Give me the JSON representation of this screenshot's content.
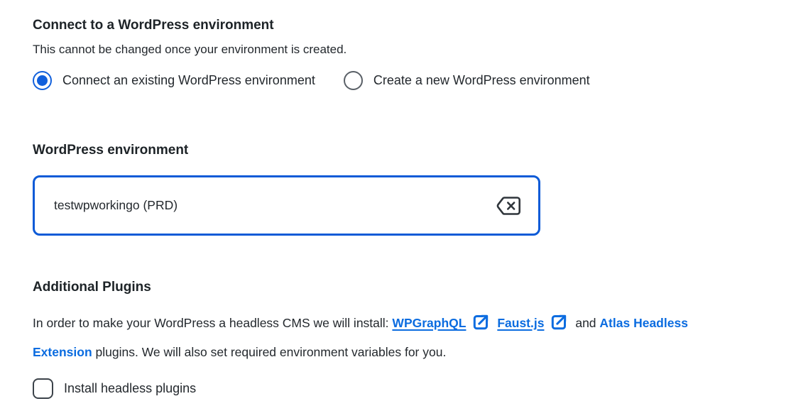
{
  "page": {
    "heading": "Connect to a WordPress environment",
    "subheading": "This cannot be changed once your environment is created."
  },
  "connection_choice": {
    "options": [
      {
        "label": "Connect an existing WordPress environment",
        "selected": true
      },
      {
        "label": "Create a new WordPress environment",
        "selected": false
      }
    ]
  },
  "environment_field": {
    "label": "WordPress environment",
    "value": "testwpworkingo (PRD)",
    "clear_icon": "backspace-clear-icon"
  },
  "plugins_section": {
    "heading": "Additional Plugins",
    "description": {
      "intro": "In order to make your WordPress a headless CMS we will install:",
      "link_wpgraphql": "WPGraphQL",
      "link_faustjs": "Faust.js",
      "conjunction": "and",
      "link_atlas": "Atlas Headless Extension",
      "outro": "plugins. We will also set required environment variables for you.",
      "external_link_icon": "external-link-icon"
    },
    "checkbox": {
      "label": "Install headless plugins",
      "checked": false
    }
  },
  "colors": {
    "accent_blue": "#1160dc",
    "input_border_blue": "#0d5bd7",
    "link_blue": "#0b6ce0",
    "heading_text": "#1d2327",
    "body_text": "#23282d"
  }
}
